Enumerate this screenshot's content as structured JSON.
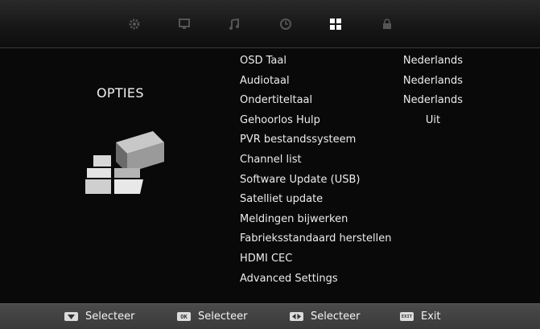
{
  "tabs": [
    {
      "name": "picture",
      "icon": "gear-icon",
      "active": false
    },
    {
      "name": "channel",
      "icon": "monitor-icon",
      "active": false
    },
    {
      "name": "sound",
      "icon": "music-note-icon",
      "active": false
    },
    {
      "name": "time",
      "icon": "clock-icon",
      "active": false
    },
    {
      "name": "options",
      "icon": "grid-icon",
      "active": true
    },
    {
      "name": "lock",
      "icon": "lock-icon",
      "active": false
    }
  ],
  "panel": {
    "title": "OPTIES",
    "icon": "options-cubes-icon"
  },
  "menu": {
    "items": [
      {
        "label": "OSD Taal",
        "value": "Nederlands"
      },
      {
        "label": "Audiotaal",
        "value": "Nederlands"
      },
      {
        "label": "Ondertiteltaal",
        "value": "Nederlands"
      },
      {
        "label": "Gehoorlos Hulp",
        "value": "Uit"
      },
      {
        "label": "PVR bestandssysteem",
        "value": ""
      },
      {
        "label": "Channel list",
        "value": ""
      },
      {
        "label": "Software Update (USB)",
        "value": ""
      },
      {
        "label": "Satelliet update",
        "value": ""
      },
      {
        "label": "Meldingen bijwerken",
        "value": ""
      },
      {
        "label": "Fabrieksstandaard herstellen",
        "value": ""
      },
      {
        "label": "HDMI CEC",
        "value": ""
      },
      {
        "label": "Advanced Settings",
        "value": ""
      }
    ]
  },
  "footer": {
    "hints": [
      {
        "key": "",
        "key_icon": "down-arrow-key-icon",
        "label": "Selecteer"
      },
      {
        "key": "OK",
        "key_icon": "ok-key-icon",
        "label": "Selecteer"
      },
      {
        "key": "",
        "key_icon": "left-right-key-icon",
        "label": "Selecteer"
      },
      {
        "key": "EXIT",
        "key_icon": "exit-key-icon",
        "label": "Exit"
      }
    ]
  },
  "colors": {
    "background": "#090909",
    "text": "#ececec",
    "footer": "#424242",
    "tab_active": "#ffffff",
    "tab_inactive": "#4a4a4a"
  }
}
